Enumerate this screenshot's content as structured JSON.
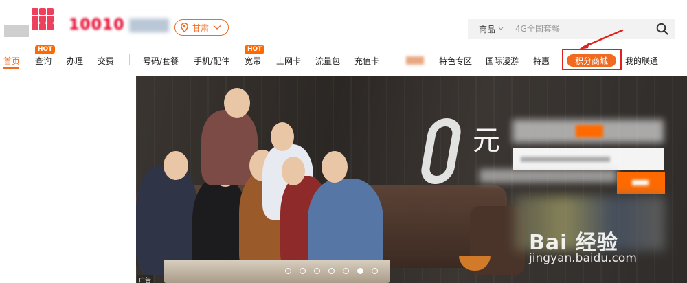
{
  "header": {
    "logo_text": "10010",
    "region": "甘肃",
    "search": {
      "category": "商品",
      "placeholder": "4G全国套餐"
    }
  },
  "nav": {
    "items": [
      {
        "label": "首页",
        "active": true
      },
      {
        "label": "查询",
        "badge": "HOT"
      },
      {
        "label": "办理"
      },
      {
        "label": "交费"
      },
      {
        "label": "号码/套餐"
      },
      {
        "label": "手机/配件"
      },
      {
        "label": "宽带",
        "badge": "HOT"
      },
      {
        "label": "上网卡"
      },
      {
        "label": "流量包"
      },
      {
        "label": "充值卡"
      },
      {
        "label": "特色专区"
      },
      {
        "label": "国际漫游"
      },
      {
        "label": "特惠"
      },
      {
        "label": "积分商城",
        "highlighted": true
      },
      {
        "label": "我的联通"
      }
    ]
  },
  "banner": {
    "headline_digit": "0",
    "headline_char": "元",
    "ad_label": "广告",
    "carousel_total": 7,
    "carousel_active": 6
  },
  "watermark": {
    "logo": "Bai 经验",
    "url": "jingyan.baidu.com"
  },
  "colors": {
    "accent": "#f06b1f",
    "brand_red": "#e60027",
    "annotation_red": "#e0201b"
  }
}
